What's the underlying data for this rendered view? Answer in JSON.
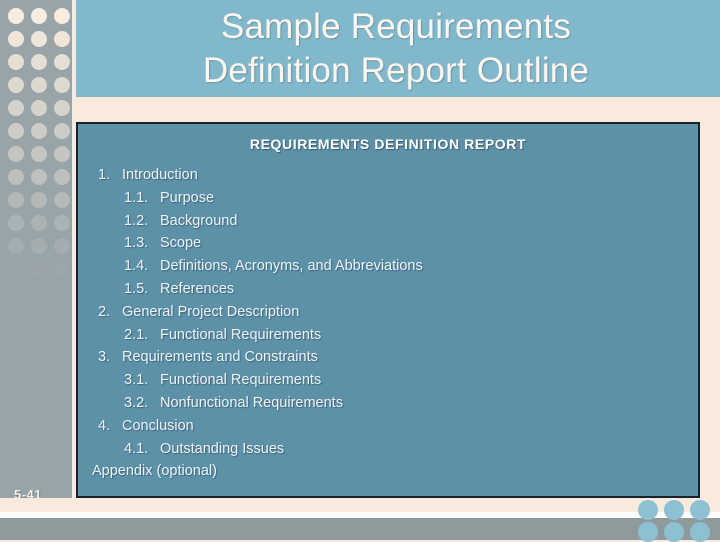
{
  "slide": {
    "title_lines": [
      "Sample Requirements",
      "Definition Report Outline"
    ],
    "page_number": "5-41",
    "colors": {
      "header_blue": "#81b8cc",
      "panel_blue": "#5d91a8",
      "panel_border": "#15222b",
      "sidebar_grey": "#99a4a8",
      "cream": "#faeade",
      "footer_grey": "#8f9a9d",
      "dot_cream": "#f7ecdd",
      "corner_dot_blue": "#8cc0d2",
      "title_text": "#fdf6ee"
    }
  },
  "panel": {
    "heading": "REQUIREMENTS DEFINITION REPORT",
    "outline": [
      {
        "level": 1,
        "number": "1.",
        "label": "Introduction"
      },
      {
        "level": 2,
        "number": "1.1.",
        "label": "Purpose"
      },
      {
        "level": 2,
        "number": "1.2.",
        "label": "Background"
      },
      {
        "level": 2,
        "number": "1.3.",
        "label": "Scope"
      },
      {
        "level": 2,
        "number": "1.4.",
        "label": "Definitions, Acronyms, and Abbreviations"
      },
      {
        "level": 2,
        "number": "1.5.",
        "label": "References"
      },
      {
        "level": 1,
        "number": "2.",
        "label": "General Project Description"
      },
      {
        "level": 2,
        "number": "2.1.",
        "label": "Functional Requirements"
      },
      {
        "level": 1,
        "number": "3.",
        "label": "Requirements and Constraints"
      },
      {
        "level": 2,
        "number": "3.1.",
        "label": "Functional Requirements"
      },
      {
        "level": 2,
        "number": "3.2.",
        "label": "Nonfunctional Requirements"
      },
      {
        "level": 1,
        "number": "4.",
        "label": "Conclusion"
      },
      {
        "level": 2,
        "number": "4.1.",
        "label": "Outstanding Issues"
      },
      {
        "level": 0,
        "number": "",
        "label": "Appendix (optional)"
      }
    ]
  },
  "decoration": {
    "sidebar_dot_columns": 3,
    "sidebar_dot_rows": 13,
    "corner_dot_columns": 3,
    "corner_dot_rows": 2
  }
}
